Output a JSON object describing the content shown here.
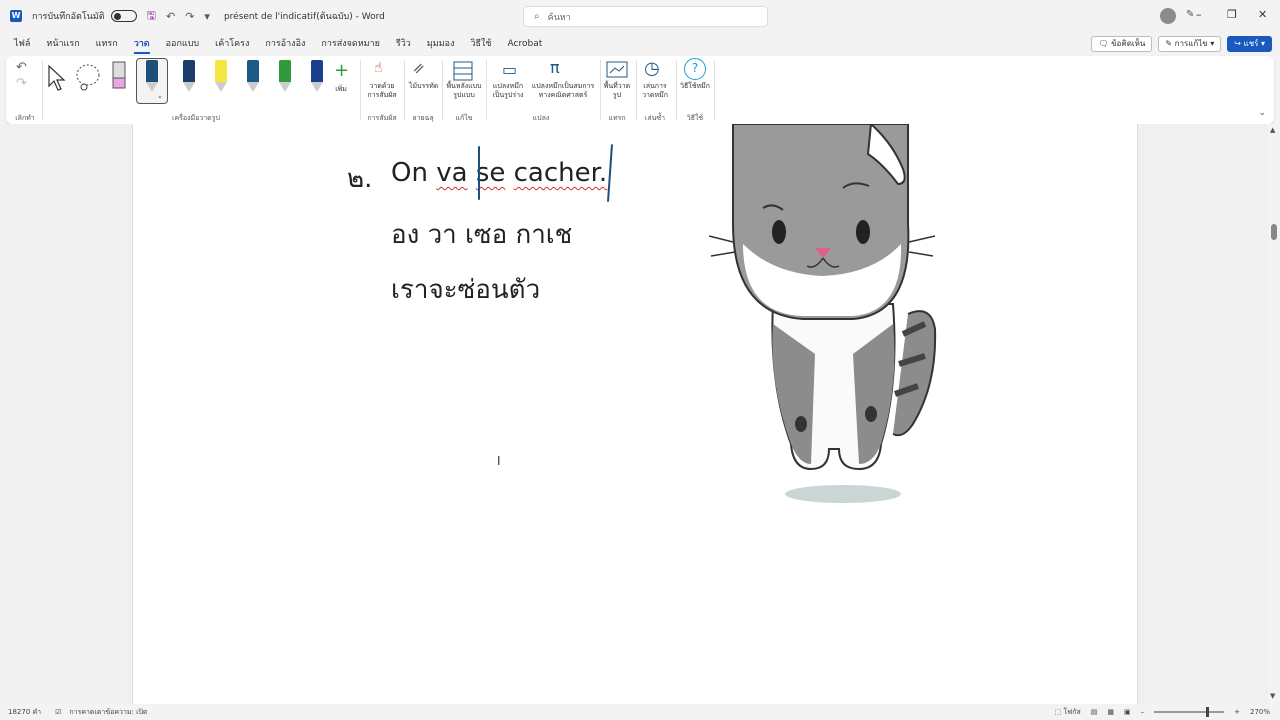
{
  "titlebar": {
    "autosave_label": "การบันทึกอัตโนมัติ",
    "doc_title": "présent de l'indicatif(ต้นฉบับ) - Word",
    "search_placeholder": "ค้นหา"
  },
  "menu": {
    "tabs": [
      "ไฟล์",
      "หน้าแรก",
      "แทรก",
      "วาด",
      "ออกแบบ",
      "เค้าโครง",
      "การอ้างอิง",
      "การส่งจดหมาย",
      "รีวิว",
      "มุมมอง",
      "วิธีใช้",
      "Acrobat"
    ],
    "active_tab": "วาด",
    "comments_label": "ข้อคิดเห็น",
    "editing_label": "การแก้ไข",
    "share_label": "แชร์"
  },
  "ribbon": {
    "add_label": "เพิ่ม",
    "draw_with_touch": "วาดด้วยการสัมผัส",
    "ruler": "ไม้บรรทัด",
    "format_background": "พื้นหลังแบบรูปแบบ",
    "ink_to_shape": "แปลงหมึกเป็นรูปร่าง",
    "ink_to_math": "แปลงหมึกเป็นสมการทางคณิตศาสตร์",
    "drawing_canvas": "พื้นที่วาดรูป",
    "ink_replay": "เล่นการวาดหมึก",
    "ink_help": "วิธีใช้หมึก",
    "groups": {
      "undo": "เลิกทำ",
      "drawing_tools": "เครื่องมือวาดรูป",
      "touch": "การสัมผัส",
      "stencils": "ลายฉลุ",
      "format": "แก้ไข",
      "convert": "แปลง",
      "insert": "แทรก",
      "replay": "เล่นซ้ำ",
      "help": "วิธีใช้"
    },
    "pen_colors": [
      "#1e4f7a",
      "#1d3d6b",
      "#f5e642",
      "#1d5a87",
      "#2f9b3b",
      "#1a3f8f"
    ]
  },
  "document": {
    "number": "๒.",
    "sentence_on": "On",
    "sentence_va": "va",
    "sentence_se": "se",
    "sentence_cacher": "cacher.",
    "pronunciation": "อง วา เซอ กาเช",
    "translation": "เราจะซ่อนตัว"
  },
  "statusbar": {
    "word_count": "18270 คำ",
    "text_prediction": "การคาดเดาข้อความ: เปิด",
    "focus": "โฟกัส",
    "zoom": "270%"
  }
}
